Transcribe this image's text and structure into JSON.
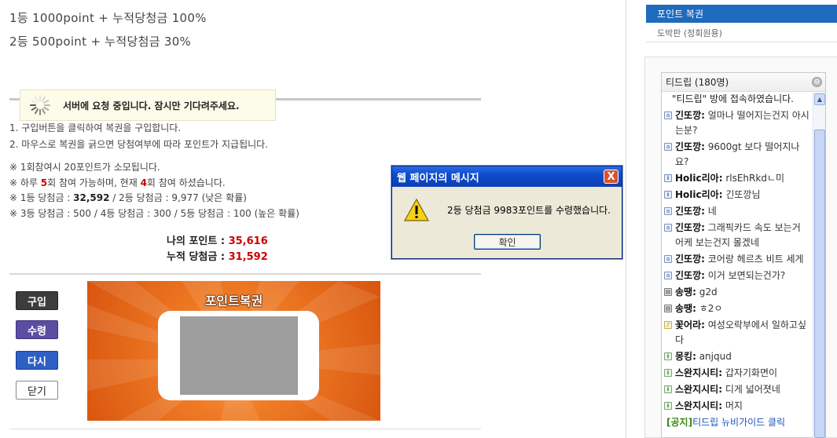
{
  "prizes": {
    "first": "1등  1000point + 누적당청금 100%",
    "second": "2등  500point + 누적당첨금 30%"
  },
  "loading": {
    "text": "서버에 요청 중입니다. 잠시만 기다려주세요."
  },
  "howto": [
    "1. 구입버튼을 클릭하여 복권을 구입합니다.",
    "2. 마우스로 복권을 긁으면 당첨여부에 따라 포인트가 지급됩니다."
  ],
  "notes": {
    "cost": "※ 1회참여시 20포인트가 소모됩니다.",
    "daily_prefix": "※ 하루 ",
    "daily_limit": "5",
    "daily_mid": "회 참여 가능하며, 현재 ",
    "daily_current": "4",
    "daily_suffix": "회 참여 하셨습니다.",
    "line3_a": "※ 1등 당첨금 : ",
    "line3_first": "32,592",
    "line3_b": " / 2등 당첨금 : 9,977 (낮은 확률)",
    "line4": "※ 3등 당첨금 : 500 / 4등 당첨금 : 300 / 5등 당첨금 : 100 (높은 확률)"
  },
  "summary": {
    "my_points_label": "나의 포인트 : ",
    "my_points": "35,616",
    "jackpot_label": "누적 당첨금 : ",
    "jackpot": "31,592"
  },
  "buttons": {
    "buy": "구입",
    "receive": "수령",
    "again": "다시",
    "close": "닫기"
  },
  "lotto": {
    "title": "포인트복권"
  },
  "dialog": {
    "title": "웹 페이지의 메시지",
    "close": "X",
    "message": "2등 당첨금 9983포인트를 수령했습니다.",
    "ok": "확인"
  },
  "sidebar": {
    "active": "포인트 복권",
    "item": "도박판 (정회원용)"
  },
  "chat": {
    "header": "티드립 (180명)",
    "system": "\"티드립\" 방에 접속하였습니다.",
    "messages": [
      {
        "icon": "a",
        "nick": "긴또깡:",
        "text": " 얼마나 떨어지는건지 아시는분?"
      },
      {
        "icon": "a",
        "nick": "긴또깡:",
        "text": " 9600gt 보다 떨어지나요?"
      },
      {
        "icon": "b",
        "nick": "Holic리아:",
        "text": " rlsEhRkdㄴ미"
      },
      {
        "icon": "b",
        "nick": "Holic리아:",
        "text": " 긴또깡님"
      },
      {
        "icon": "a",
        "nick": "긴또깡:",
        "text": " 네"
      },
      {
        "icon": "a",
        "nick": "긴또깡:",
        "text": " 그래픽카드 속도 보는거 어케 보는건지 몰겠네"
      },
      {
        "icon": "a",
        "nick": "긴또깡:",
        "text": " 코어랑 헤르츠 비트 세게"
      },
      {
        "icon": "a",
        "nick": "긴또깡:",
        "text": " 이거 보면되는건가?"
      },
      {
        "icon": "k",
        "nick": "송땡:",
        "text": " g2d"
      },
      {
        "icon": "k",
        "nick": "송땡:",
        "text": " ㅎ2ㅇ"
      },
      {
        "icon": "y",
        "nick": "꽃어라:",
        "text": " 여성오락부에서 일하고싶다"
      },
      {
        "icon": "g",
        "nick": "몽킹:",
        "text": " anjqud"
      },
      {
        "icon": "g",
        "nick": "스완지시티:",
        "text": " 갑자기화면이"
      },
      {
        "icon": "g",
        "nick": "스완지시티:",
        "text": " 디게 넓어졋네"
      },
      {
        "icon": "g",
        "nick": "스완지시티:",
        "text": " 머지"
      }
    ],
    "notice_tag": "[공지]",
    "notice_text": "티드립 뉴비가이드 클릭"
  }
}
